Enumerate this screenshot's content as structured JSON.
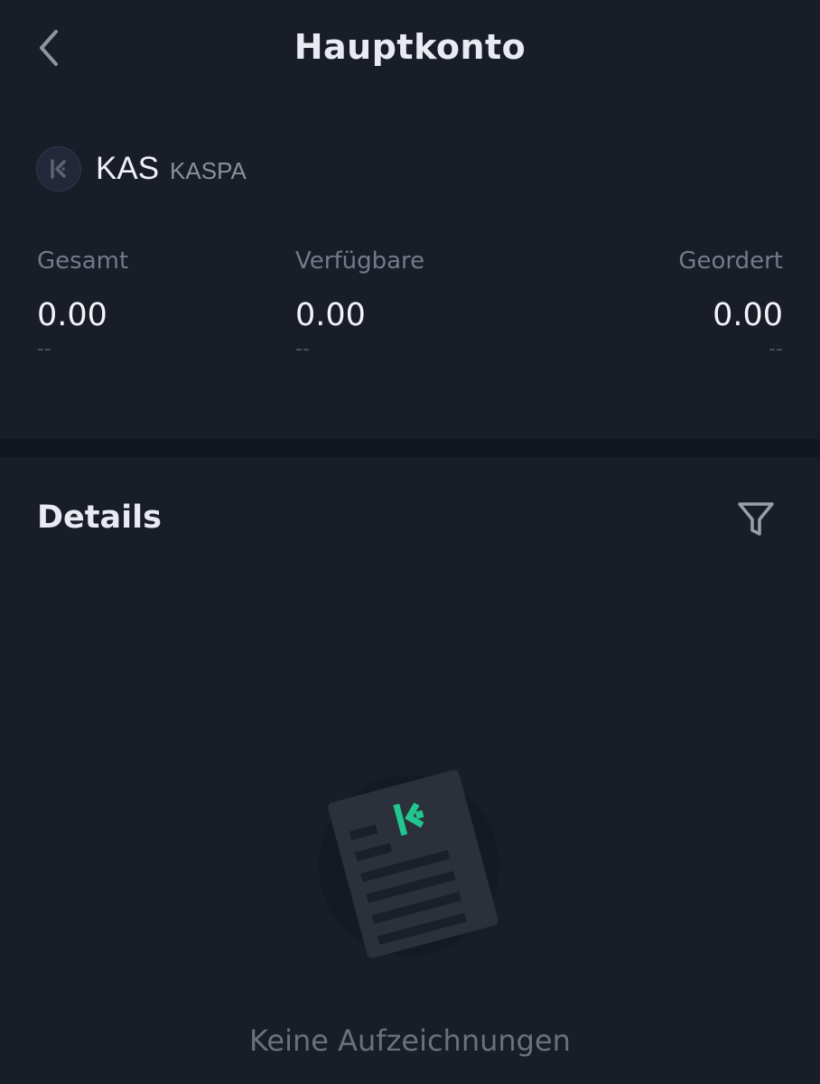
{
  "header": {
    "title": "Hauptkonto",
    "back_icon": "chevron-left-icon"
  },
  "coin": {
    "symbol": "KAS",
    "name": "KASPA",
    "logo_icon": "kucoin-logo-icon"
  },
  "balances": {
    "total": {
      "label": "Gesamt",
      "value": "0.00",
      "sub": "--"
    },
    "available": {
      "label": "Verfügbare",
      "value": "0.00",
      "sub": "--"
    },
    "ordered": {
      "label": "Geordert",
      "value": "0.00",
      "sub": "--"
    }
  },
  "details": {
    "title": "Details",
    "filter_icon": "filter-icon"
  },
  "empty_state": {
    "text": "Keine Aufzeichnungen",
    "illustration_icon": "empty-document-icon"
  },
  "colors": {
    "background": "#181d28",
    "divider": "#12161f",
    "accent": "#23c58e"
  }
}
